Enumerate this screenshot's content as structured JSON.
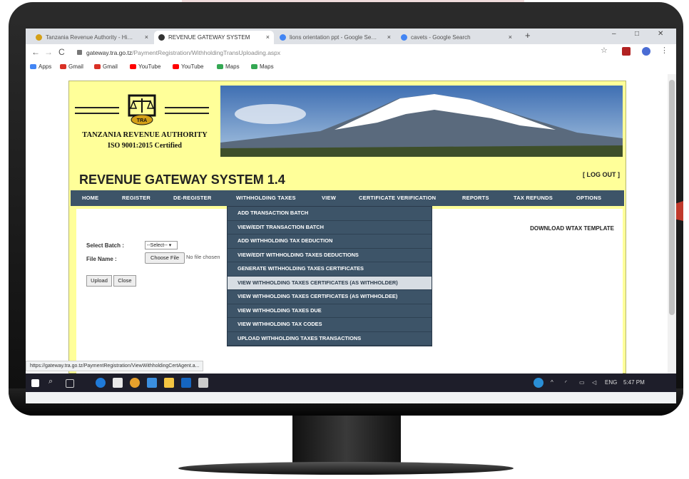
{
  "browser": {
    "tabs": [
      {
        "label": "Tanzania Revenue Authority - Hi…",
        "favicon": "tra-favicon",
        "color": "#d4a017",
        "active": false
      },
      {
        "label": "REVENUE GATEWAY SYSTEM",
        "favicon": "globe-icon",
        "color": "#333333",
        "active": true
      },
      {
        "label": "lions orientation ppt - Google Se…",
        "favicon": "google-icon",
        "color": "#4285f4",
        "active": false
      },
      {
        "label": "cavets - Google Search",
        "favicon": "google-icon",
        "color": "#4285f4",
        "active": false
      }
    ],
    "tab_close": "×",
    "new_tab": "+",
    "window_controls": {
      "minimize": "–",
      "maximize": "□",
      "close": "✕"
    },
    "nav": {
      "back": "←",
      "forward": "→",
      "reload": "C"
    },
    "url_host": "gateway.tra.go.tz",
    "url_path": "/PaymentRegistration/WithholdingTransUploading.aspx",
    "bookmarks": [
      {
        "label": "Apps",
        "color": "#4285f4"
      },
      {
        "label": "Gmail",
        "color": "#d93025"
      },
      {
        "label": "Gmail",
        "color": "#d93025"
      },
      {
        "label": "YouTube",
        "color": "#ff0000"
      },
      {
        "label": "YouTube",
        "color": "#ff0000"
      },
      {
        "label": "Maps",
        "color": "#34a853"
      },
      {
        "label": "Maps",
        "color": "#34a853"
      }
    ],
    "status_url": "https://gateway.tra.go.tz/PaymentRegistration/ViewWithholdingCertAgent.a..."
  },
  "site": {
    "org_name": "TANZANIA REVENUE AUTHORITY",
    "certification": "ISO 9001:2015 Certified",
    "logo_text": "TRA",
    "system_title": "REVENUE GATEWAY SYSTEM 1.4",
    "logout": "[ LOG OUT ]",
    "menu": [
      "HOME",
      "REGISTER",
      "DE-REGISTER",
      "WITHHOLDING TAXES",
      "VIEW",
      "CERTIFICATE VERIFICATION",
      "REPORTS",
      "TAX REFUNDS",
      "OPTIONS"
    ],
    "dropdown": [
      "ADD TRANSACTION BATCH",
      "VIEW/EDIT TRANSACTION BATCH",
      "ADD WITHHOLDING TAX DEDUCTION",
      "VIEW/EDIT WITHHOLDING TAXES DEDUCTIONS",
      "GENERATE WITHHOLDING TAXES CERTIFICATES",
      "VIEW WITHHOLDING TAXES CERTIFICATES (AS WITHHOLDER)",
      "VIEW WITHHOLDING TAXES CERTIFICATES (AS WITHHOLDEE)",
      "VIEW WITHHOLDING TAXES DUE",
      "VIEW WITHHOLDING TAX CODES",
      "UPLOAD WITHHOLDING TAXES TRANSACTIONS"
    ],
    "dropdown_highlighted_index": 5,
    "form": {
      "batch_label": "Select Batch :",
      "batch_value": "--Select-- ▾",
      "file_label": "File Name :",
      "choose_file": "Choose File",
      "no_file": "No file chosen",
      "upload": "Upload",
      "close": "Close",
      "download_template": "DOWNLOAD WTAX TEMPLATE"
    },
    "colors": {
      "page_bg": "#ffff99",
      "menu_bg": "#3d5468",
      "highlight": "#d7dde3"
    }
  },
  "taskbar": {
    "language": "ENG",
    "time": "5:47 PM",
    "icons": [
      "windows-start-icon",
      "search-icon",
      "task-view-icon",
      "edge-icon",
      "mail-icon",
      "chrome-icon",
      "store-icon",
      "file-explorer-icon",
      "outlook-icon",
      "photos-icon"
    ]
  }
}
